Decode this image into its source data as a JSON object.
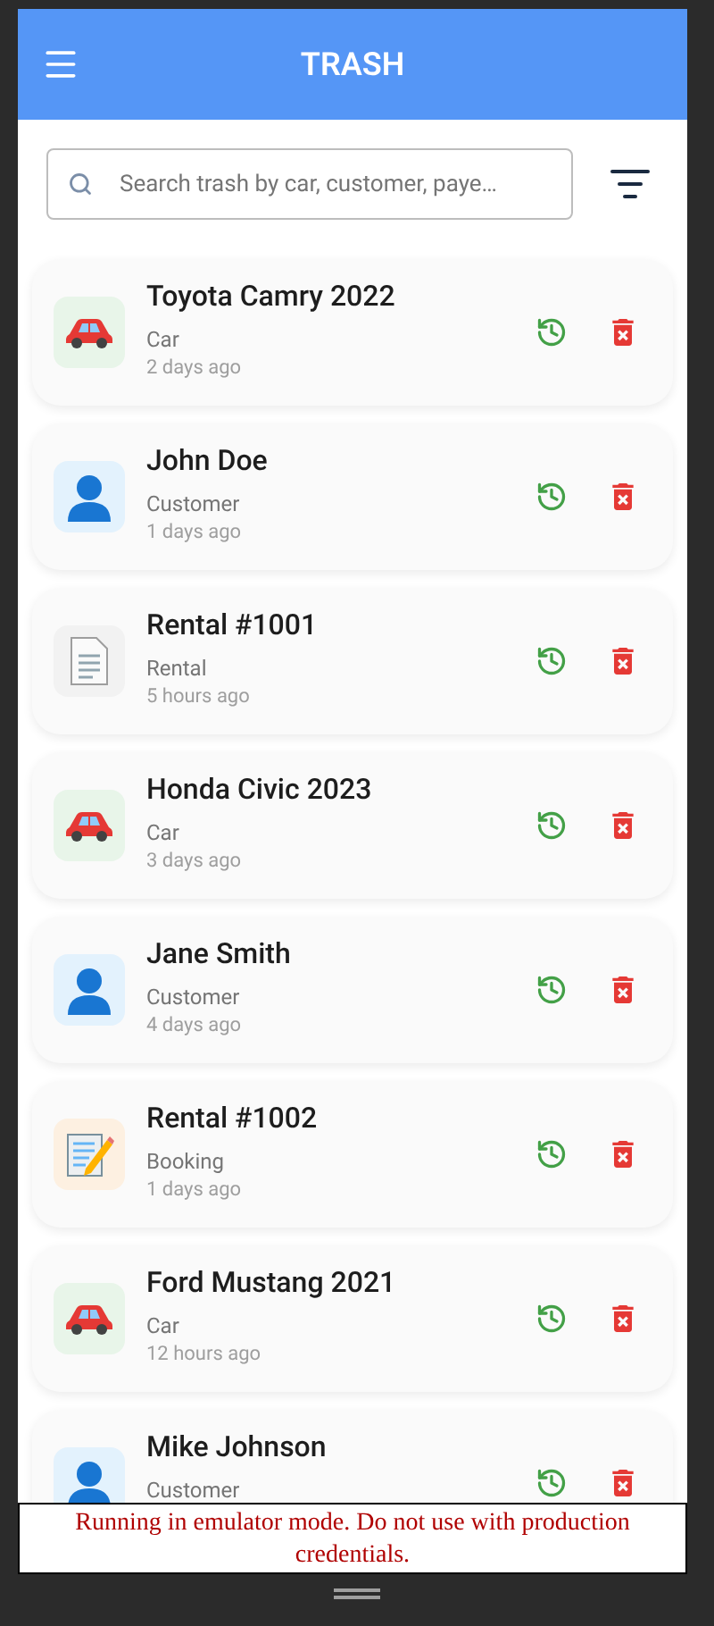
{
  "app_bar": {
    "title": "TRASH"
  },
  "search": {
    "placeholder": "Search trash by car, customer, paye…"
  },
  "items": [
    {
      "kind": "car",
      "title": "Toyota Camry 2022",
      "type": "Car",
      "time": "2 days ago"
    },
    {
      "kind": "customer",
      "title": "John Doe",
      "type": "Customer",
      "time": "1 days ago"
    },
    {
      "kind": "rental",
      "title": "Rental #1001",
      "type": "Rental",
      "time": "5 hours ago"
    },
    {
      "kind": "car",
      "title": "Honda Civic 2023",
      "type": "Car",
      "time": "3 days ago"
    },
    {
      "kind": "customer",
      "title": "Jane Smith",
      "type": "Customer",
      "time": "4 days ago"
    },
    {
      "kind": "booking",
      "title": "Rental #1002",
      "type": "Booking",
      "time": "1 days ago"
    },
    {
      "kind": "car",
      "title": "Ford Mustang 2021",
      "type": "Car",
      "time": "12 hours ago"
    },
    {
      "kind": "customer",
      "title": "Mike Johnson",
      "type": "Customer"
    }
  ],
  "banner": {
    "text": "Running in emulator mode. Do not use with production credentials."
  }
}
